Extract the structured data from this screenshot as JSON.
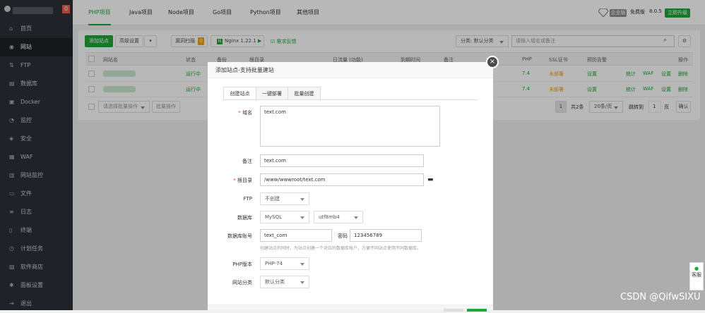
{
  "sidebar": {
    "badge": "0",
    "items": [
      {
        "label": "首页",
        "icon": "home-icon"
      },
      {
        "label": "网站",
        "icon": "globe-icon"
      },
      {
        "label": "FTP",
        "icon": "ftp-icon"
      },
      {
        "label": "数据库",
        "icon": "database-icon"
      },
      {
        "label": "Docker",
        "icon": "docker-icon"
      },
      {
        "label": "监控",
        "icon": "monitor-icon"
      },
      {
        "label": "安全",
        "icon": "shield-icon"
      },
      {
        "label": "WAF",
        "icon": "waf-icon"
      },
      {
        "label": "网站监控",
        "icon": "chart-icon"
      },
      {
        "label": "文件",
        "icon": "folder-icon"
      },
      {
        "label": "日志",
        "icon": "log-icon"
      },
      {
        "label": "终端",
        "icon": "terminal-icon"
      },
      {
        "label": "计划任务",
        "icon": "clock-icon"
      },
      {
        "label": "软件商店",
        "icon": "store-icon"
      },
      {
        "label": "面板设置",
        "icon": "gear-icon"
      },
      {
        "label": "退出",
        "icon": "logout-icon"
      }
    ]
  },
  "topbar": {
    "tabs": [
      "PHP项目",
      "Java项目",
      "Node项目",
      "Go项目",
      "Python项目",
      "其他项目"
    ],
    "enterprise_badge": "企业版",
    "free_label": "免费版",
    "version": "8.0.5",
    "upgrade_label": "立即升级"
  },
  "toolbar": {
    "add_site": "添加站点",
    "advanced": "高级设置",
    "scan": "漏洞扫描",
    "scan_count": "0",
    "nginx": "Nginx 1.22.1",
    "feedback": "需求反馈",
    "category": "分类: 默认分类",
    "search_placeholder": "请输入域名或备注"
  },
  "table": {
    "headers": [
      "网站名",
      "状态",
      "备份",
      "根目录",
      "日流量 (功能)",
      "到期时间",
      "备注",
      "PHP",
      "SSL证书",
      "预防告警",
      "操作"
    ],
    "rows": [
      {
        "status": "运行中",
        "php": "7.4",
        "ssl": "未部署",
        "alarm": "设置",
        "actions": [
          "统计",
          "WAF",
          "设置",
          "删除"
        ]
      },
      {
        "status": "运行中",
        "php": "7.4",
        "ssl": "未部署",
        "alarm": "设置",
        "actions": [
          "统计",
          "WAF",
          "设置",
          "删除"
        ]
      }
    ],
    "batch_placeholder": "请选择批量操作",
    "batch_button": "批量操作",
    "pager": {
      "page": "1",
      "total": "共2条",
      "per_page": "20条/页",
      "jump_label": "跳转到",
      "jump_value": "1",
      "page_unit": "页",
      "confirm": "确认"
    }
  },
  "modal": {
    "title": "添加站点-支持批量建站",
    "tabs": [
      "创建站点",
      "一键部署",
      "批量创建"
    ],
    "domain_label": "域名",
    "domain_value": "text.com",
    "remark_label": "备注",
    "remark_value": "text.com",
    "root_label": "根目录",
    "root_value": "/www/wwwroot/text.com",
    "ftp_label": "FTP",
    "ftp_value": "不创建",
    "db_label": "数据库",
    "db_value": "MySQL",
    "db_charset": "utf8mb4",
    "db_account_label": "数据库账号",
    "db_account_value": "text_com",
    "db_pass_label": "密码",
    "db_pass_value": "123456789",
    "db_hint": "创建站点的同时，为站点创建一个对应的数据库帐户，方便不同站点使用不同数据库。",
    "php_label": "PHP版本",
    "php_value": "PHP-74",
    "cat_label": "网站分类",
    "cat_value": "默认分类"
  },
  "side_float": "客服",
  "watermark": "CSDN @QifwSIXU"
}
